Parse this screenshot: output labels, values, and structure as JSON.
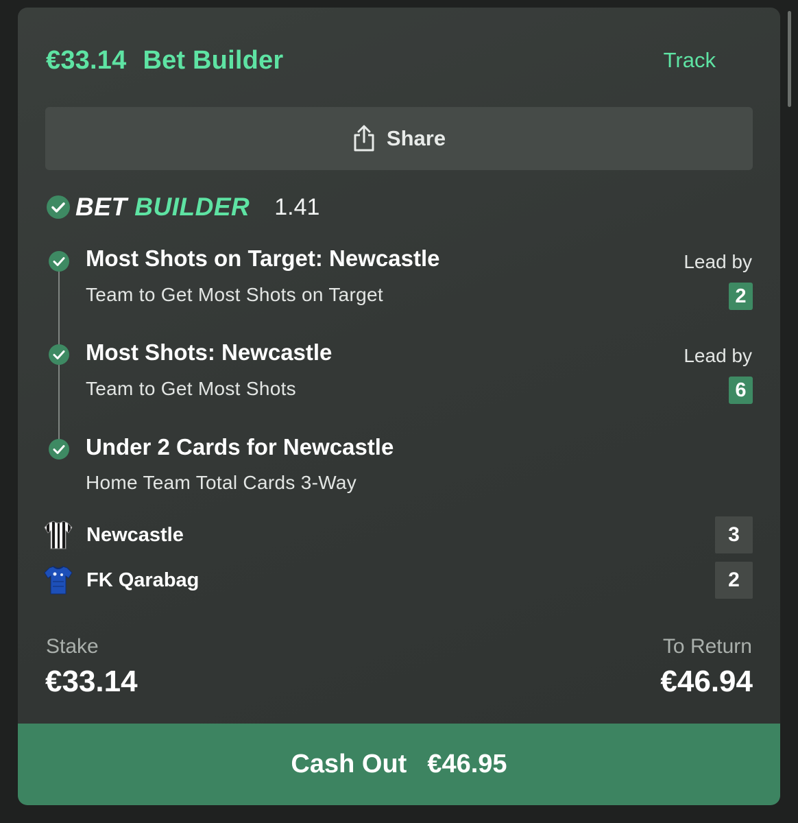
{
  "header": {
    "amount": "€33.14",
    "title": "Bet Builder",
    "track_label": "Track"
  },
  "share": {
    "label": "Share",
    "icon": "share-icon"
  },
  "bet_builder": {
    "logo_white": "BET",
    "logo_green": "BUILDER",
    "odds": "1.41"
  },
  "legs": [
    {
      "title": "Most Shots on Target: Newcastle",
      "subtitle": "Team to Get Most Shots on Target",
      "lead_label": "Lead by",
      "lead_value": "2"
    },
    {
      "title": "Most Shots: Newcastle",
      "subtitle": "Team to Get Most Shots",
      "lead_label": "Lead by",
      "lead_value": "6"
    },
    {
      "title": "Under 2 Cards for Newcastle",
      "subtitle": "Home Team Total Cards 3-Way"
    }
  ],
  "teams": [
    {
      "name": "Newcastle",
      "score": "3"
    },
    {
      "name": "FK Qarabag",
      "score": "2"
    }
  ],
  "stake": {
    "label": "Stake",
    "value": "€33.14"
  },
  "to_return": {
    "label": "To Return",
    "value": "€46.94"
  },
  "cashout": {
    "label": "Cash Out",
    "amount": "€46.95"
  },
  "colors": {
    "accent": "#5ee3a3",
    "success": "#3e8a63",
    "cashout": "#3d8461",
    "card_bg": "#353936"
  }
}
